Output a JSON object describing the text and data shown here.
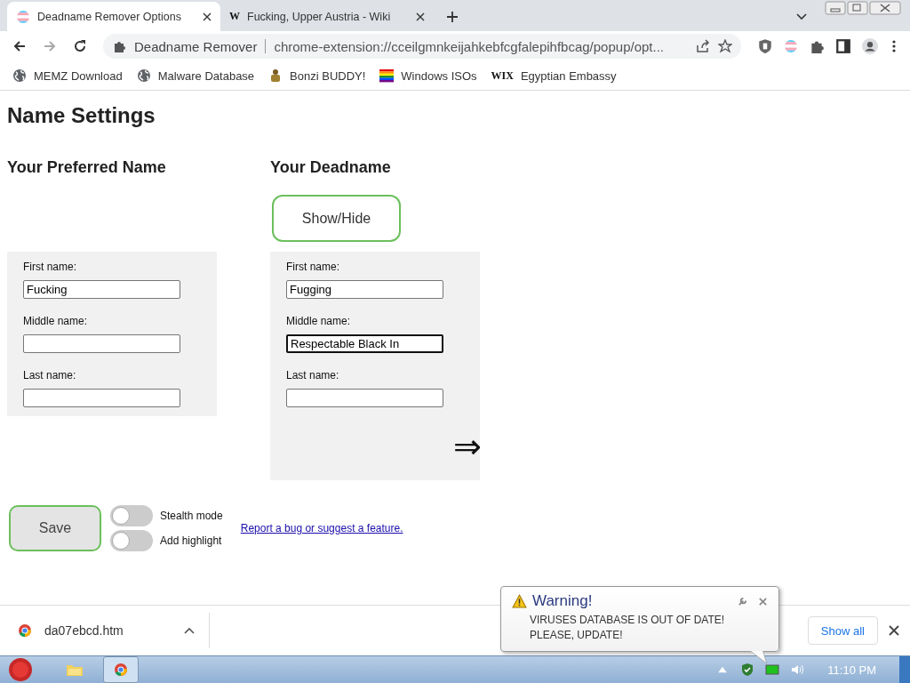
{
  "browser": {
    "tabs": [
      {
        "title": "Deadname Remover Options",
        "selected": true,
        "kind": "flag"
      },
      {
        "title": "Fucking, Upper Austria - Wiki",
        "selected": false,
        "kind": "letter",
        "icon_text": "W"
      }
    ],
    "address": {
      "site": "Deadname Remover",
      "url": "chrome-extension://cceilgmnkeijahkebfcgfalepihfbcag/popup/opt..."
    },
    "bookmarks": [
      {
        "label": "MEMZ Download",
        "kind": "globe"
      },
      {
        "label": "Malware Database",
        "kind": "globe"
      },
      {
        "label": "Bonzi BUDDY!",
        "kind": "figure"
      },
      {
        "label": "Windows ISOs",
        "kind": "rainbow"
      },
      {
        "label": "Egyptian Embassy",
        "kind": "letter",
        "icon_text": "WIX"
      }
    ]
  },
  "page": {
    "heading": "Name Settings",
    "columns": [
      {
        "heading": "Your Preferred Name",
        "fields": [
          {
            "label": "First name:",
            "value": "Fucking",
            "focused": false
          },
          {
            "label": "Middle name:",
            "focused": false
          },
          {
            "label": "Last name:",
            "focused": false
          }
        ]
      },
      {
        "heading": "Your Deadname",
        "toggle_button": "Show/Hide",
        "arrow": "⇒",
        "fields": [
          {
            "label": "First name:",
            "value": "Fugging",
            "focused": false
          },
          {
            "label": "Middle name:",
            "value": "Respectable Black In",
            "focused": true
          },
          {
            "label": "Last name:",
            "focused": false
          }
        ]
      }
    ],
    "save_button": "Save",
    "switches": [
      {
        "label": "Stealth mode",
        "on": false
      },
      {
        "label": "Add highlight",
        "on": false
      }
    ],
    "link": "Report a bug or suggest a feature."
  },
  "downloads": {
    "file": "da07ebcd.htm",
    "show_all": "Show all"
  },
  "notification": {
    "title": "Warning!",
    "message": "VIRUSES DATABASE IS OUT OF DATE! PLEASE, UPDATE!"
  },
  "taskbar": {
    "clock": "11:10 PM"
  }
}
